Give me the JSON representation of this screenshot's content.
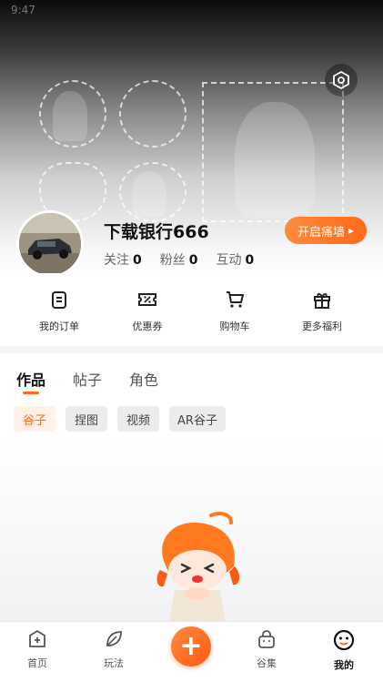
{
  "status": {
    "time": "9:47"
  },
  "profile": {
    "username": "下载银行666",
    "wall_button": "开启痛墙",
    "stats": [
      {
        "label": "关注",
        "value": "0"
      },
      {
        "label": "粉丝",
        "value": "0"
      },
      {
        "label": "互动",
        "value": "0"
      }
    ]
  },
  "quick_actions": [
    {
      "label": "我的订单",
      "icon": "order-icon"
    },
    {
      "label": "优惠券",
      "icon": "coupon-icon"
    },
    {
      "label": "购物车",
      "icon": "cart-icon"
    },
    {
      "label": "更多福利",
      "icon": "gift-icon"
    }
  ],
  "content_tabs": [
    {
      "label": "作品",
      "active": true
    },
    {
      "label": "帖子",
      "active": false
    },
    {
      "label": "角色",
      "active": false
    }
  ],
  "filter_chips": [
    {
      "label": "谷子",
      "active": true
    },
    {
      "label": "捏图",
      "active": false
    },
    {
      "label": "视频",
      "active": false
    },
    {
      "label": "AR谷子",
      "active": false
    }
  ],
  "tabbar": [
    {
      "label": "首页",
      "icon": "home-icon"
    },
    {
      "label": "玩法",
      "icon": "leaf-icon"
    },
    {
      "label": "谷集",
      "icon": "bag-icon"
    },
    {
      "label": "我的",
      "icon": "face-icon",
      "active": true
    }
  ],
  "colors": {
    "accent": "#ff6a1a"
  }
}
